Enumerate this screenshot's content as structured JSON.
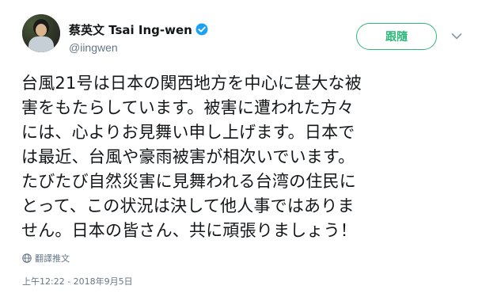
{
  "author": {
    "fullname": "蔡英文 Tsai Ing-wen",
    "username": "@iingwen",
    "verified_icon": "verified-badge-icon",
    "avatar_icon": "profile-avatar"
  },
  "actions": {
    "follow_label": "跟隨",
    "menu_icon": "chevron-down-icon"
  },
  "tweet": {
    "lines": [
      "台風21号は日本の関西地方を中心に甚大な被",
      "害をもたらしています。被害に遭われた方々",
      "には、心よりお見舞い申し上げます。日本で",
      "は最近、台風や豪雨被害が相次いでいます。",
      "たびたび自然災害に見舞われる台湾の住民に",
      "とって、この状況は決して他人事ではありま",
      "せん。日本の皆さん、共に頑張りましょう！"
    ],
    "translate_label": "翻譯推文",
    "translate_icon": "globe-icon",
    "timestamp": "上午12:22 - 2018年9月5日"
  },
  "colors": {
    "follow_accent": "#2fb67c",
    "verified_blue": "#1da1f2",
    "muted_text": "#657786",
    "main_text": "#14171a"
  }
}
